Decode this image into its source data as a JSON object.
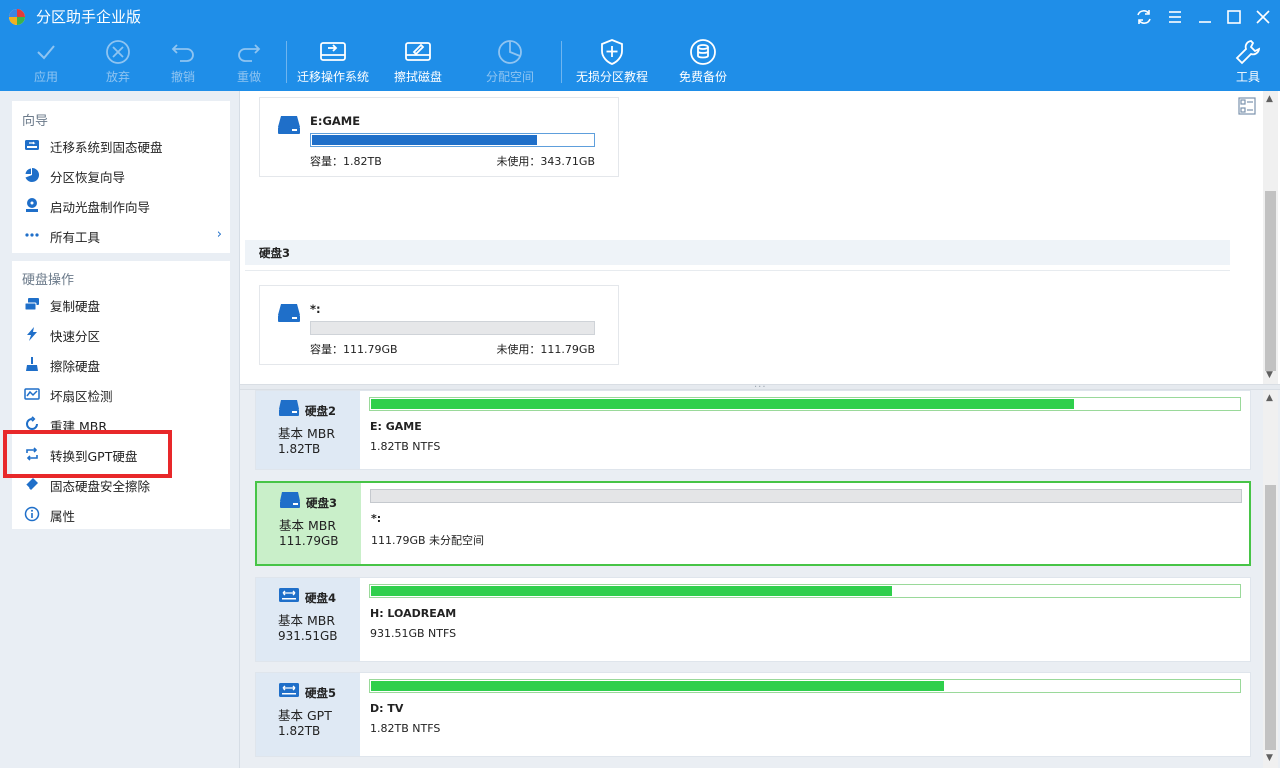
{
  "app": {
    "title": "分区助手企业版"
  },
  "toolbar": {
    "apply": "应用",
    "discard": "放弃",
    "undo": "撤销",
    "redo": "重做",
    "migrate_os": "迁移操作系统",
    "wipe_disk": "擦拭磁盘",
    "allocate_space": "分配空间",
    "tutorial": "无损分区教程",
    "backup": "免费备份",
    "tools": "工具"
  },
  "sidebar": {
    "wizard_title": "向导",
    "wizard_items": [
      {
        "label": "迁移系统到固态硬盘",
        "icon": "ssd-migrate-icon"
      },
      {
        "label": "分区恢复向导",
        "icon": "pie-recover-icon"
      },
      {
        "label": "启动光盘制作向导",
        "icon": "boot-disc-icon"
      },
      {
        "label": "所有工具",
        "icon": "more-dots-icon"
      }
    ],
    "disk_ops_title": "硬盘操作",
    "disk_ops_items": [
      {
        "label": "复制硬盘",
        "icon": "copy-disk-icon"
      },
      {
        "label": "快速分区",
        "icon": "lightning-icon"
      },
      {
        "label": "擦除硬盘",
        "icon": "brush-icon"
      },
      {
        "label": "坏扇区检测",
        "icon": "sector-check-icon"
      },
      {
        "label": "重建 MBR",
        "icon": "rebuild-icon"
      },
      {
        "label": "转换到GPT硬盘",
        "icon": "convert-icon"
      },
      {
        "label": "固态硬盘安全擦除",
        "icon": "eraser-icon"
      },
      {
        "label": "属性",
        "icon": "info-icon"
      }
    ]
  },
  "upper": {
    "volume_e": {
      "name": "E:GAME",
      "capacity": "容量：1.82TB",
      "free": "未使用：343.71GB",
      "used_fraction": 0.8
    },
    "disk3_header": "硬盘3",
    "volume_star": {
      "name": "*:",
      "capacity": "容量：111.79GB",
      "free": "未使用：111.79GB",
      "used_fraction": 0
    }
  },
  "disks": [
    {
      "name": "硬盘2",
      "type": "基本 MBR",
      "size": "1.82TB",
      "part_name": "E: GAME",
      "part_detail": "1.82TB NTFS",
      "used_fraction": 0.81,
      "selected": false,
      "icon": "disk-icon"
    },
    {
      "name": "硬盘3",
      "type": "基本 MBR",
      "size": "111.79GB",
      "part_name": "*:",
      "part_detail": "111.79GB 未分配空间",
      "used_fraction": 0,
      "selected": true,
      "icon": "disk-icon"
    },
    {
      "name": "硬盘4",
      "type": "基本 MBR",
      "size": "931.51GB",
      "part_name": "H: LOADREAM",
      "part_detail": "931.51GB NTFS",
      "used_fraction": 0.6,
      "selected": false,
      "icon": "disk-arrows-icon"
    },
    {
      "name": "硬盘5",
      "type": "基本 GPT",
      "size": "1.82TB",
      "part_name": "D: TV",
      "part_detail": "1.82TB NTFS",
      "used_fraction": 0.66,
      "selected": false,
      "icon": "disk-arrows-icon"
    }
  ],
  "colors": {
    "titlebar": "#1f8ee8",
    "accent": "#1f6fc9",
    "used_green": "#2fcf4c",
    "used_blue": "#1f6fc9",
    "highlight_red": "#e8282a"
  }
}
